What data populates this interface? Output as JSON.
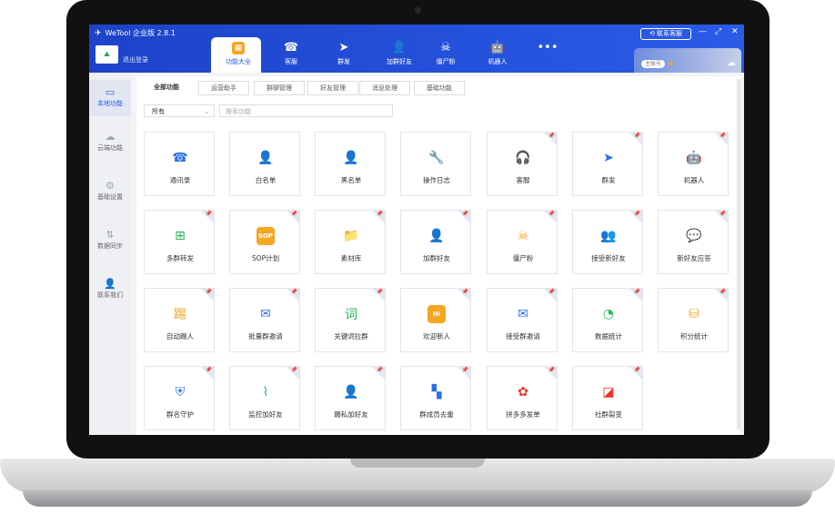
{
  "window": {
    "title": "WeTool 企业版 2.8.1",
    "support_label": "联系客服",
    "logout_label": "退出登录",
    "logo_text": "⛰",
    "account_badge": "主账号"
  },
  "nav_tabs": [
    {
      "label": "功能大全",
      "icon": "▦"
    },
    {
      "label": "客服",
      "icon": "☎"
    },
    {
      "label": "群发",
      "icon": "➤"
    },
    {
      "label": "加群好友",
      "icon": "👤"
    },
    {
      "label": "僵尸粉",
      "icon": "☠"
    },
    {
      "label": "机器人",
      "icon": "🤖"
    },
    {
      "label": "",
      "icon": "•••"
    }
  ],
  "sidebar": [
    {
      "label": "本地功能",
      "icon": "▭"
    },
    {
      "label": "云端功能",
      "icon": "☁"
    },
    {
      "label": "基础设置",
      "icon": "⚙"
    },
    {
      "label": "数据同步",
      "icon": "⇅"
    },
    {
      "label": "联系我们",
      "icon": "👤"
    }
  ],
  "sub_tabs": [
    "全部功能",
    "运营助手",
    "群聊管理",
    "好友管理",
    "消息处理",
    "基础功能"
  ],
  "filter": {
    "selected": "所有",
    "search_placeholder": "搜索功能"
  },
  "features": [
    {
      "label": "通讯录",
      "icon": "☎",
      "color": "#2a6fe8",
      "pinned": false
    },
    {
      "label": "白名单",
      "icon": "👤",
      "color": "#2db35a",
      "pinned": false
    },
    {
      "label": "黑名单",
      "icon": "👤",
      "color": "#f5a623",
      "pinned": false
    },
    {
      "label": "操作日志",
      "icon": "🔧",
      "color": "#2a6fe8",
      "pinned": false
    },
    {
      "label": "客服",
      "icon": "🎧",
      "color": "#2db35a",
      "pinned": true
    },
    {
      "label": "群发",
      "icon": "➤",
      "color": "#2a6fe8",
      "pinned": true
    },
    {
      "label": "机器人",
      "icon": "🤖",
      "color": "#2a6fe8",
      "pinned": true
    },
    {
      "label": "多群转发",
      "icon": "⊞",
      "color": "#2db35a",
      "pinned": true
    },
    {
      "label": "SOP计划",
      "icon": "SOP",
      "color": "#f5a623",
      "pinned": true
    },
    {
      "label": "素材库",
      "icon": "📁",
      "color": "#2a6fe8",
      "pinned": true
    },
    {
      "label": "加群好友",
      "icon": "👤",
      "color": "#2db35a",
      "pinned": true
    },
    {
      "label": "僵尸粉",
      "icon": "☠",
      "color": "#f5a623",
      "pinned": true
    },
    {
      "label": "接受新好友",
      "icon": "👥",
      "color": "#2a6fe8",
      "pinned": true
    },
    {
      "label": "新好友应答",
      "icon": "💬",
      "color": "#2db35a",
      "pinned": true
    },
    {
      "label": "自动踢人",
      "icon": "踢",
      "color": "#f5a623",
      "pinned": true
    },
    {
      "label": "批量群邀请",
      "icon": "✉",
      "color": "#2a6fe8",
      "pinned": true
    },
    {
      "label": "关键词拉群",
      "icon": "词",
      "color": "#2db35a",
      "pinned": true
    },
    {
      "label": "欢迎新人",
      "icon": "Hi",
      "color": "#f5a623",
      "pinned": true
    },
    {
      "label": "接受群邀请",
      "icon": "✉",
      "color": "#2a6fe8",
      "pinned": true
    },
    {
      "label": "数据统计",
      "icon": "◔",
      "color": "#2db35a",
      "pinned": true
    },
    {
      "label": "积分统计",
      "icon": "⛁",
      "color": "#f5a623",
      "pinned": true
    },
    {
      "label": "群名守护",
      "icon": "⛨",
      "color": "#2a6fe8",
      "pinned": true
    },
    {
      "label": "监控加好友",
      "icon": "⌇",
      "color": "#2db35a",
      "pinned": true
    },
    {
      "label": "踢私加好友",
      "icon": "👤",
      "color": "#f5a623",
      "pinned": true
    },
    {
      "label": "群成员去重",
      "icon": "▚",
      "color": "#2a6fe8",
      "pinned": true
    },
    {
      "label": "拼多多发单",
      "icon": "✿",
      "color": "#e8362b",
      "pinned": true
    },
    {
      "label": "社群裂变",
      "icon": "◪",
      "color": "#e8362b",
      "pinned": true
    }
  ]
}
